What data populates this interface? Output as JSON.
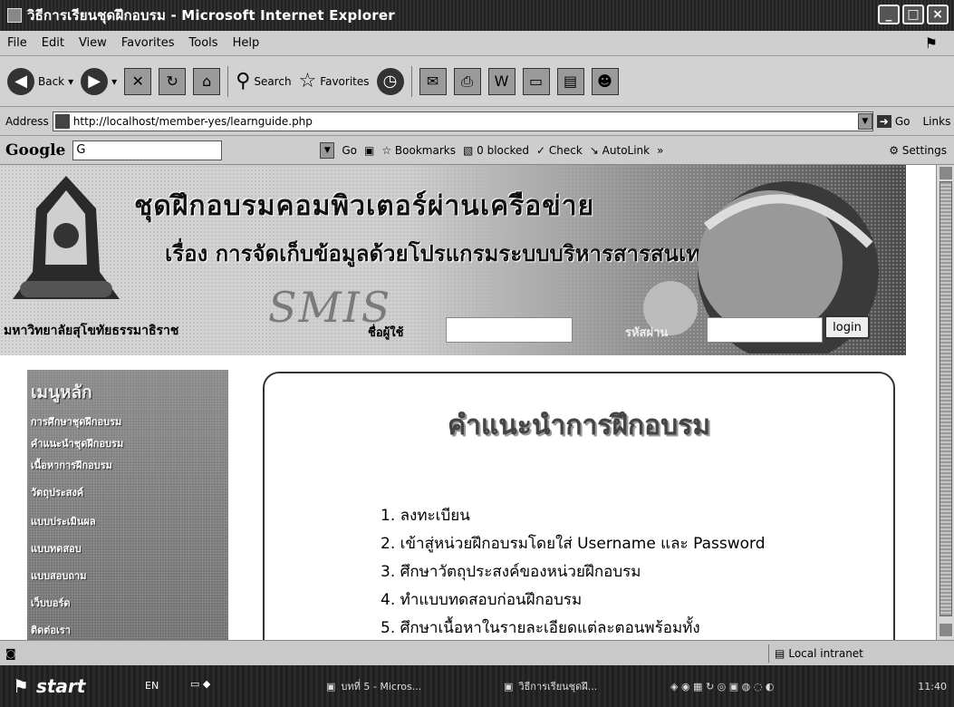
{
  "window": {
    "title": "วิธีการเรียนชุดฝึกอบรม - Microsoft Internet Explorer"
  },
  "menubar": {
    "items": [
      "File",
      "Edit",
      "View",
      "Favorites",
      "Tools",
      "Help"
    ]
  },
  "toolbar": {
    "back": "Back",
    "search": "Search",
    "favorites": "Favorites"
  },
  "address": {
    "label": "Address",
    "url": "http://localhost/member-yes/learnguide.php",
    "go": "Go",
    "links": "Links"
  },
  "googlebar": {
    "logo": "Google",
    "input": "G",
    "go": "Go",
    "bookmarks": "Bookmarks",
    "blocked": "0 blocked",
    "check": "Check",
    "autolink": "AutoLink",
    "settings": "Settings"
  },
  "banner": {
    "title1": "ชุดฝึกอบรมคอมพิวเตอร์ผ่านเครือข่าย",
    "title2": "เรื่อง การจัดเก็บข้อมูลด้วยโปรแกรมระบบบริหารสารสนเทศสถานศึกษา",
    "smis": "SMIS",
    "university": "มหาวิทยาลัยสุโขทัยธรรมาธิราช",
    "user_label": "ชื่อผู้ใช้",
    "pass_label": "รหัสผ่าน",
    "login": "login"
  },
  "sidebar": {
    "heading": "เมนูหลัก",
    "items": [
      "การศึกษาชุดฝึกอบรม",
      "คำแนะนำชุดฝึกอบรม",
      "เนื้อหาการฝึกอบรม",
      "วัตถุประสงค์",
      "แบบประเมินผล",
      "แบบทดสอบ",
      "แบบสอบถาม",
      "เว็บบอร์ด",
      "ติดต่อเรา"
    ]
  },
  "content": {
    "heading": "คำแนะนำการฝึกอบรม",
    "steps": [
      "1. ลงทะเบียน",
      "2. เข้าสู่หน่วยฝึกอบรมโดยใส่ Username และ Password",
      "3. ศึกษาวัตถุประสงค์ของหน่วยฝึกอบรม",
      "4. ทำแบบทดสอบก่อนฝึกอบรม",
      "5. ศึกษาเนื้อหาในรายละเอียดแต่ละตอนพร้อมทั้ง"
    ]
  },
  "status": {
    "zone": "Local intranet"
  },
  "taskbar": {
    "start": "start",
    "lang": "EN",
    "tasks": [
      "บทที่ 5 - Micros...",
      "วิธีการเรียนชุดฝึ..."
    ],
    "clock": "11:40"
  }
}
